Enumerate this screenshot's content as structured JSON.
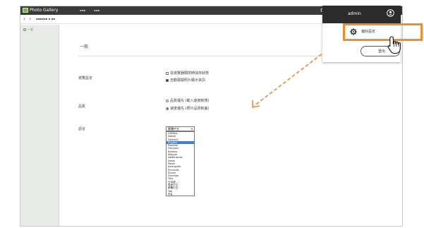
{
  "app": {
    "title": "Photo Gallery",
    "menu_items": [
      "▪▪▪",
      "▪▪▪"
    ]
  },
  "subbar": {
    "breadcrumb": "▪▪▪▪▪▪ ▪ ▪▪"
  },
  "sidebar": {
    "items": [
      {
        "label": "一般"
      }
    ]
  },
  "settings": {
    "section_title": "一般",
    "browse": {
      "label": "瀏覽設定",
      "options": [
        {
          "label": "從瀏覽器關閉時儲存狀態",
          "checked": false
        },
        {
          "label": "自動展開照片顯示資訊",
          "checked": true
        }
      ]
    },
    "quality": {
      "label": "品質",
      "options": [
        {
          "label": "品質優先 (載入速度較慢)",
          "selected": false
        },
        {
          "label": "速度優先 (照片品質較差)",
          "selected": true
        }
      ]
    },
    "language": {
      "label": "語言",
      "selected": "繁體中文",
      "options": [
        "Čeština",
        "Dansk",
        "Deutsch",
        "English",
        "Español",
        "Français",
        "Italiano",
        "Magyar",
        "Nederlands",
        "Norsk",
        "Polski",
        "português",
        "Русский",
        "Suomi",
        "Svenska",
        "Türk",
        "日本語",
        "简体中文",
        "繁體中文",
        "ไทย",
        "한글"
      ],
      "highlighted": "English"
    }
  },
  "user_menu": {
    "username": "admin",
    "preferences_label": "偏好設定",
    "logout_label": "登出"
  },
  "colors": {
    "accent": "#f28c2a",
    "topbar": "#3a3a3a",
    "menu_header": "#2b2b2b",
    "selection": "#3f7fd6"
  }
}
